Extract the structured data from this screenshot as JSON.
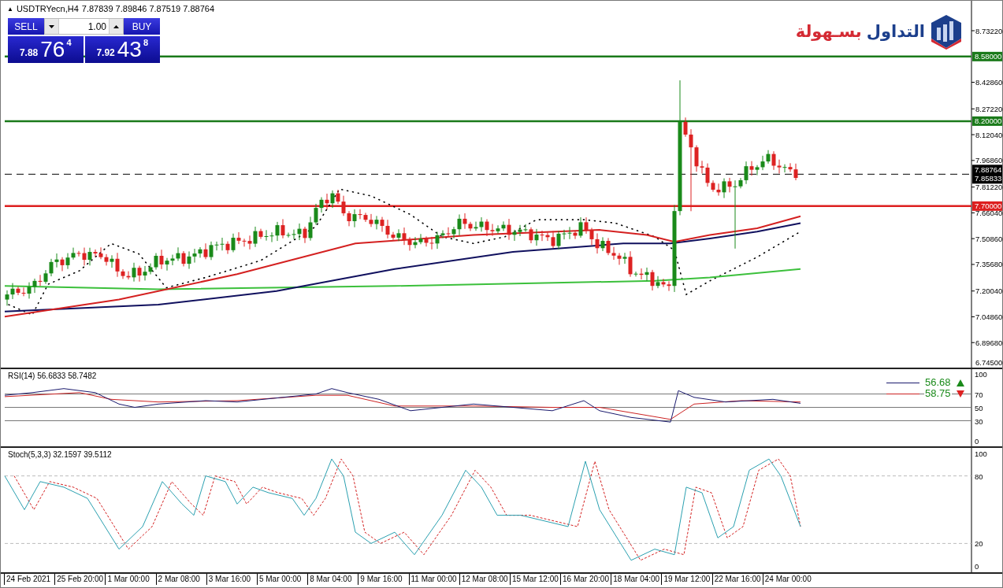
{
  "symbol_bar": {
    "arrow": "▲",
    "title": "USDTRYecn,H4",
    "ohlc": "7.87839 7.89846 7.87519 7.88764"
  },
  "trade_panel": {
    "sell_label": "SELL",
    "buy_label": "BUY",
    "lot": "1.00",
    "sell_price": {
      "big": "7.88",
      "pips": "76",
      "point": "4"
    },
    "buy_price": {
      "big": "7.92",
      "pips": "43",
      "point": "8"
    }
  },
  "logo": {
    "words": [
      {
        "text": "التداول",
        "color": "#1c3f8c"
      },
      {
        "text": "بسـهولة",
        "color": "#d42a33"
      }
    ]
  },
  "price_axis": {
    "ticks": [
      "8.73220",
      "8.42860",
      "8.27220",
      "8.12040",
      "7.96860",
      "7.81220",
      "7.66040",
      "7.50860",
      "7.35680",
      "7.20040",
      "7.04860",
      "6.89680",
      "6.74500"
    ]
  },
  "levels": [
    {
      "label": "8.58000",
      "color": "#1a7a1a"
    },
    {
      "label": "8.20000",
      "color": "#1a7a1a"
    },
    {
      "label": "7.70000",
      "color": "#dd1f1f"
    }
  ],
  "current_price": {
    "bid": "7.88764",
    "ask": "7.85833"
  },
  "rsi": {
    "title": "RSI(14) 56.6833 58.7482",
    "ticks": [
      "100",
      "70",
      "50",
      "30",
      "0"
    ],
    "legend": [
      {
        "value": "56.68",
        "rising": true,
        "color": "#1a1a6e"
      },
      {
        "value": "58.75",
        "rising": false,
        "color": "#cc2222"
      }
    ]
  },
  "stoch": {
    "title": "Stoch(5,3,3) 32.1597 39.5112",
    "ticks": [
      "100",
      "80",
      "20",
      "0"
    ]
  },
  "time_axis": [
    "24 Feb 2021",
    "25 Feb 20:00",
    "1 Mar 00:00",
    "2 Mar 08:00",
    "3 Mar 16:00",
    "5 Mar 00:00",
    "8 Mar 04:00",
    "9 Mar 16:00",
    "11 Mar 00:00",
    "12 Mar 08:00",
    "15 Mar 12:00",
    "16 Mar 20:00",
    "18 Mar 04:00",
    "19 Mar 12:00",
    "22 Mar 16:00",
    "24 Mar 00:00"
  ]
}
